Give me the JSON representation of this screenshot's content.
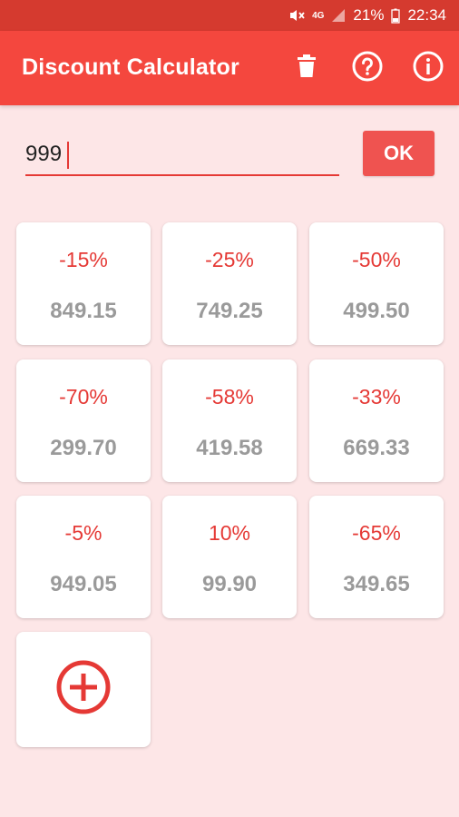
{
  "status_bar": {
    "network": "4G",
    "battery_percent": "21%",
    "time": "22:34"
  },
  "app_bar": {
    "title": "Discount Calculator",
    "actions": [
      "delete-icon",
      "help-icon",
      "info-icon"
    ]
  },
  "input": {
    "value": "999",
    "ok_label": "OK"
  },
  "discounts": [
    {
      "percent": "-15%",
      "result": "849.15"
    },
    {
      "percent": "-25%",
      "result": "749.25"
    },
    {
      "percent": "-50%",
      "result": "499.50"
    },
    {
      "percent": "-70%",
      "result": "299.70"
    },
    {
      "percent": "-58%",
      "result": "419.58"
    },
    {
      "percent": "-33%",
      "result": "669.33"
    },
    {
      "percent": "-5%",
      "result": "949.05"
    },
    {
      "percent": "10%",
      "result": "99.90"
    },
    {
      "percent": "-65%",
      "result": "349.65"
    }
  ],
  "add_card": {
    "icon": "add-circle-icon"
  },
  "colors": {
    "status_bar": "#d53a2f",
    "app_bar": "#f4473e",
    "background": "#fde6e7",
    "accent": "#e53935",
    "value_text": "#9a9a9a"
  }
}
